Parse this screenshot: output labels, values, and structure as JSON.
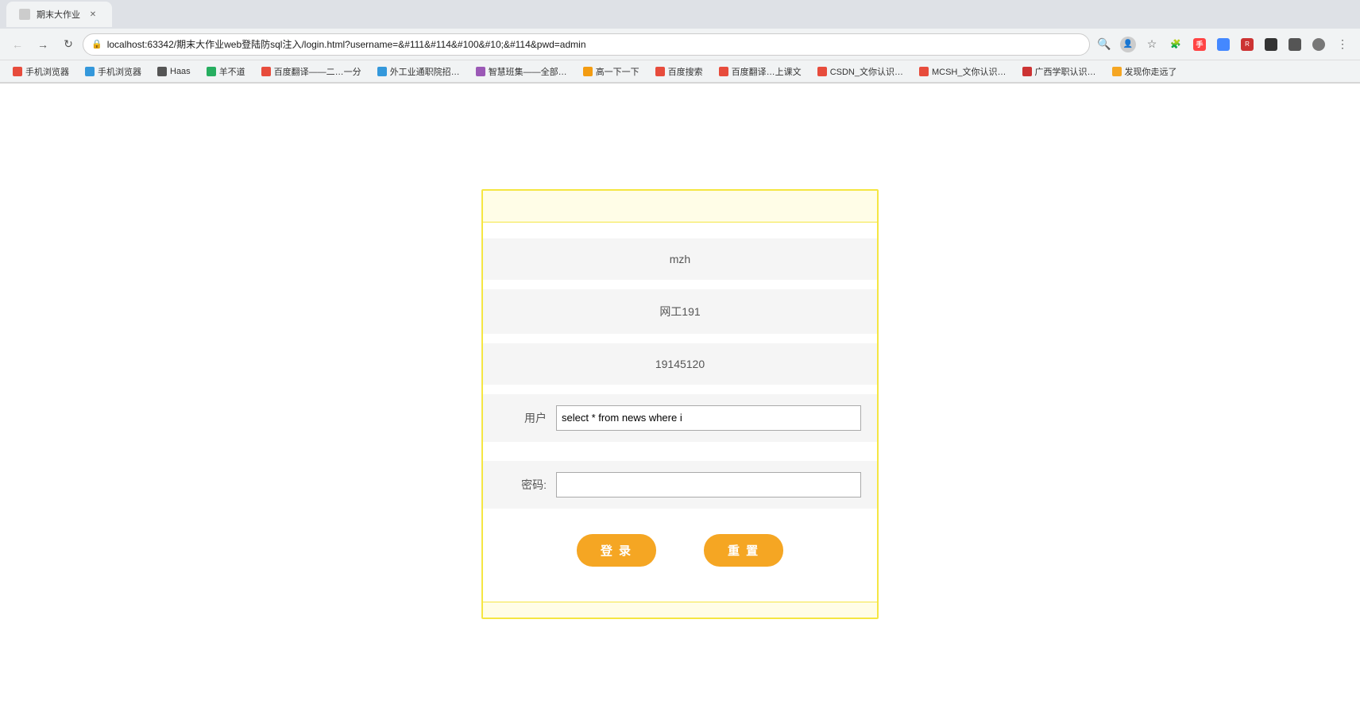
{
  "browser": {
    "tab_title": "localhost:63342/期末大作业web登陆防sql注入/login.html?username=...",
    "address": "localhost:63342/期末大作业web登陆防sql注入/login.html?username=&#111&#114&#100&#10;&#114&pwd=admin",
    "bookmarks": [
      {
        "label": "手机浏览器"
      },
      {
        "label": "手机浏览器"
      },
      {
        "label": "Haas"
      },
      {
        "label": "羊不道"
      },
      {
        "label": "百度翻译——二…一分"
      },
      {
        "label": "外工业通职院招…"
      },
      {
        "label": "智慧班集——全部…"
      },
      {
        "label": "高一下一下"
      },
      {
        "label": "百度搜索"
      },
      {
        "label": "百度翻译…上课文"
      },
      {
        "label": "CSDN_文你认识…"
      },
      {
        "label": "MCSH_文你认识…"
      },
      {
        "label": "广西学职认识…"
      },
      {
        "label": "发现你走远了"
      }
    ]
  },
  "login_form": {
    "info1": "mzh",
    "info2": "网工191",
    "info3": "19145120",
    "username_label": "用户",
    "username_value": "select * from news where i",
    "password_label": "密码:",
    "password_value": "",
    "login_btn": "登 录",
    "reset_btn": "重 置"
  }
}
